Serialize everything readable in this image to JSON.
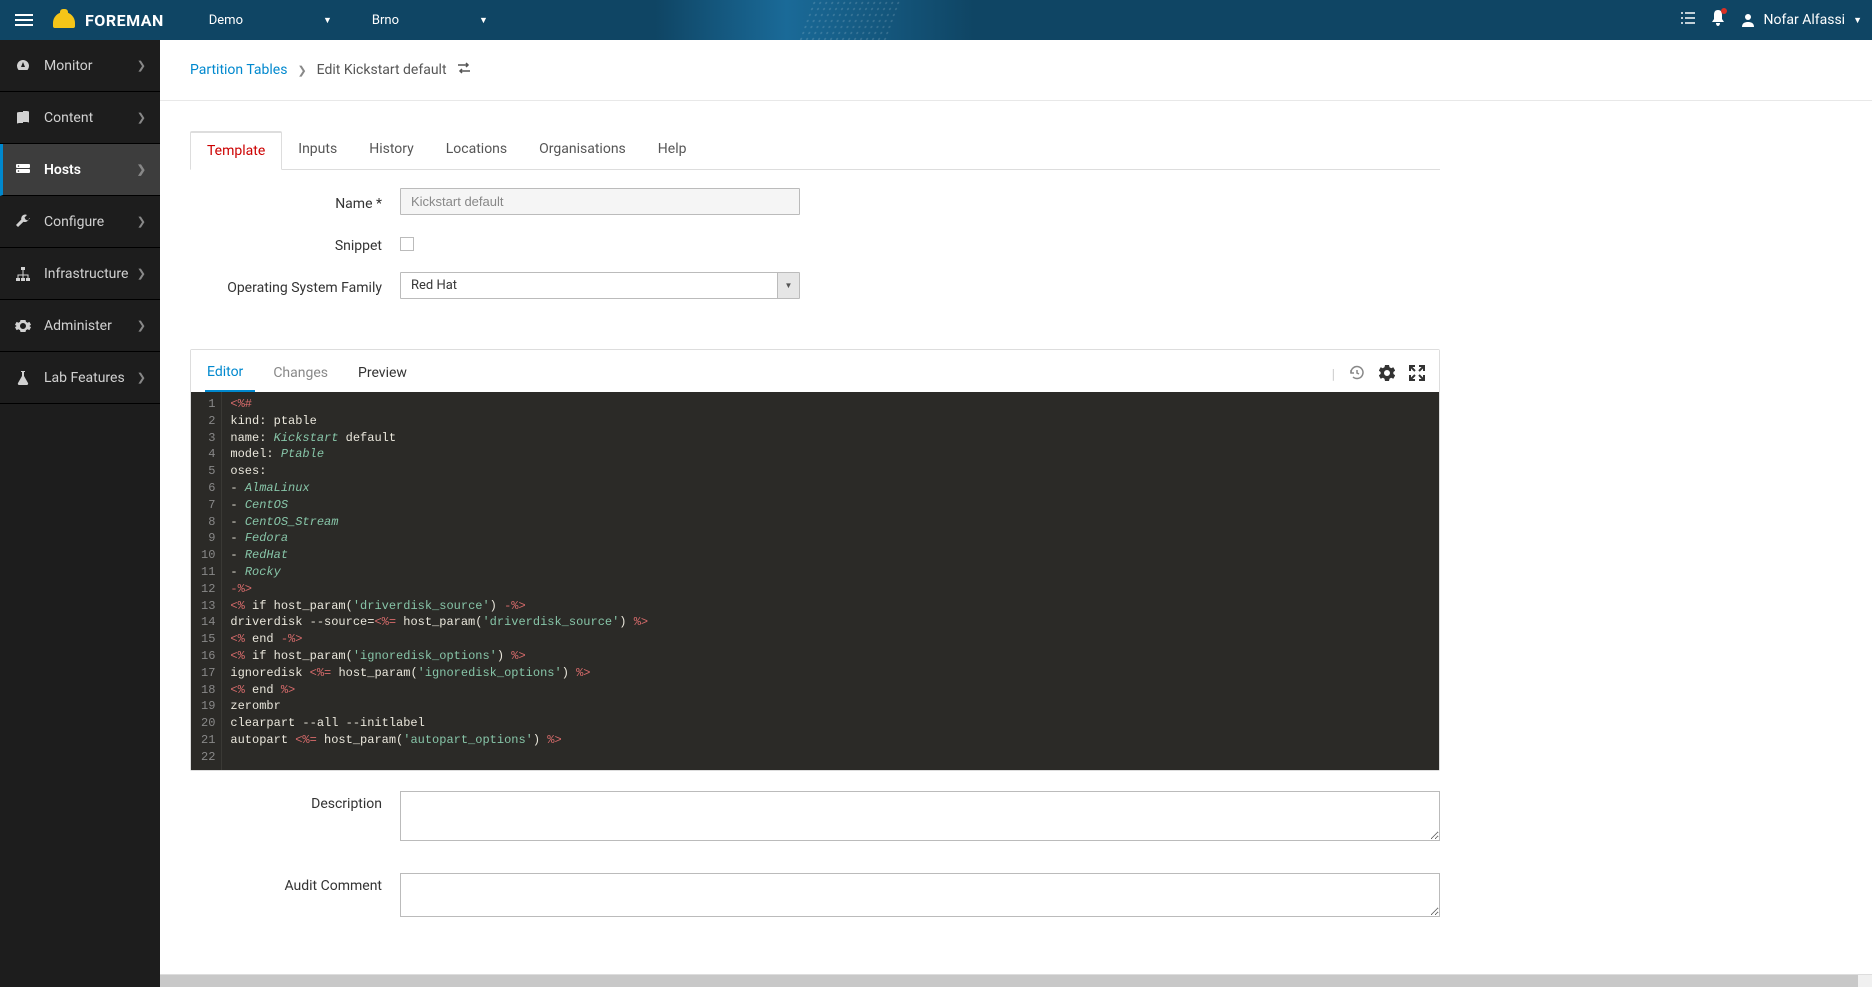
{
  "header": {
    "brand": "FOREMAN",
    "org": "Demo",
    "location": "Brno",
    "user": "Nofar Alfassi"
  },
  "sidebar": {
    "items": [
      {
        "icon": "dashboard",
        "label": "Monitor"
      },
      {
        "icon": "book",
        "label": "Content"
      },
      {
        "icon": "server",
        "label": "Hosts",
        "active": true
      },
      {
        "icon": "wrench",
        "label": "Configure"
      },
      {
        "icon": "network",
        "label": "Infrastructure"
      },
      {
        "icon": "gear",
        "label": "Administer"
      },
      {
        "icon": "flask",
        "label": "Lab Features"
      }
    ]
  },
  "breadcrumb": {
    "parent": "Partition Tables",
    "current": "Edit Kickstart default"
  },
  "tabs": [
    "Template",
    "Inputs",
    "History",
    "Locations",
    "Organisations",
    "Help"
  ],
  "form": {
    "name_label": "Name *",
    "name_value": "Kickstart default",
    "snippet_label": "Snippet",
    "osfamily_label": "Operating System Family",
    "osfamily_value": "Red Hat",
    "description_label": "Description",
    "audit_label": "Audit Comment"
  },
  "editor": {
    "tabs": {
      "editor": "Editor",
      "changes": "Changes",
      "preview": "Preview"
    },
    "code": [
      {
        "n": 1,
        "html": "<span class='tok-erb'>&lt;%#</span>"
      },
      {
        "n": 2,
        "html": "<span class='tok-key'>kind</span>: <span class='tok-plain'>ptable</span>"
      },
      {
        "n": 3,
        "html": "<span class='tok-key'>name</span>: <span class='tok-val'>Kickstart</span> <span class='tok-plain'>default</span>"
      },
      {
        "n": 4,
        "html": "<span class='tok-key'>model</span>: <span class='tok-val'>Ptable</span>"
      },
      {
        "n": 5,
        "html": "<span class='tok-key'>oses</span>:"
      },
      {
        "n": 6,
        "html": "- <span class='tok-val'>AlmaLinux</span>"
      },
      {
        "n": 7,
        "html": "- <span class='tok-val'>CentOS</span>"
      },
      {
        "n": 8,
        "html": "- <span class='tok-val'>CentOS_Stream</span>"
      },
      {
        "n": 9,
        "html": "- <span class='tok-val'>Fedora</span>"
      },
      {
        "n": 10,
        "html": "- <span class='tok-val'>RedHat</span>"
      },
      {
        "n": 11,
        "html": "- <span class='tok-val'>Rocky</span>"
      },
      {
        "n": 12,
        "html": "<span class='tok-erb'>-%&gt;</span>"
      },
      {
        "n": 13,
        "html": "<span class='tok-erb'>&lt;%</span> <span class='tok-plain'>if host_param(</span><span class='tok-str'>'driverdisk_source'</span><span class='tok-plain'>)</span> <span class='tok-erb'>-%&gt;</span>"
      },
      {
        "n": 14,
        "html": "<span class='tok-plain'>driverdisk --source=</span><span class='tok-erb'>&lt;%=</span> <span class='tok-plain'>host_param(</span><span class='tok-str'>'driverdisk_source'</span><span class='tok-plain'>)</span> <span class='tok-erb'>%&gt;</span>"
      },
      {
        "n": 15,
        "html": "<span class='tok-erb'>&lt;%</span> <span class='tok-plain'>end</span> <span class='tok-erb'>-%&gt;</span>"
      },
      {
        "n": 16,
        "html": "<span class='tok-erb'>&lt;%</span> <span class='tok-plain'>if host_param(</span><span class='tok-str'>'ignoredisk_options'</span><span class='tok-plain'>)</span> <span class='tok-erb'>%&gt;</span>"
      },
      {
        "n": 17,
        "html": "<span class='tok-plain'>ignoredisk </span><span class='tok-erb'>&lt;%=</span> <span class='tok-plain'>host_param(</span><span class='tok-str'>'ignoredisk_options'</span><span class='tok-plain'>)</span> <span class='tok-erb'>%&gt;</span>"
      },
      {
        "n": 18,
        "html": "<span class='tok-erb'>&lt;%</span> <span class='tok-plain'>end</span> <span class='tok-erb'>%&gt;</span>"
      },
      {
        "n": 19,
        "html": "<span class='tok-plain'>zerombr</span>"
      },
      {
        "n": 20,
        "html": "<span class='tok-plain'>clearpart --all --initlabel</span>"
      },
      {
        "n": 21,
        "html": "<span class='tok-plain'>autopart </span><span class='tok-erb'>&lt;%=</span> <span class='tok-plain'>host_param(</span><span class='tok-str'>'autopart_options'</span><span class='tok-plain'>)</span> <span class='tok-erb'>%&gt;</span>"
      },
      {
        "n": 22,
        "html": ""
      }
    ]
  }
}
